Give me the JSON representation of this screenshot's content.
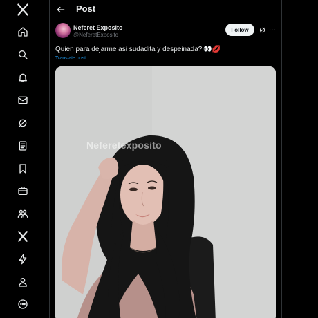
{
  "nav": {
    "items": [
      {
        "icon": "x-logo-icon"
      },
      {
        "icon": "home-icon"
      },
      {
        "icon": "search-icon"
      },
      {
        "icon": "notifications-icon"
      },
      {
        "icon": "messages-icon"
      },
      {
        "icon": "grok-icon"
      },
      {
        "icon": "lists-icon"
      },
      {
        "icon": "bookmarks-icon"
      },
      {
        "icon": "jobs-icon"
      },
      {
        "icon": "communities-icon"
      },
      {
        "icon": "premium-icon"
      },
      {
        "icon": "verified-orgs-icon"
      },
      {
        "icon": "profile-icon"
      },
      {
        "icon": "more-icon"
      }
    ]
  },
  "header": {
    "title": "Post"
  },
  "post": {
    "author_name": "Neferet Exposito",
    "author_handle": "@NeferetExposito",
    "follow_label": "Follow",
    "text": "Quien para dejarme asi sudadita y despeinada?",
    "emojis": "👀💋",
    "translate_label": "Translate post",
    "media_watermark": "Neferetexposito"
  },
  "colors": {
    "background": "#000000",
    "text": "#e7e9ea",
    "muted": "#71767b",
    "link": "#1d9bf0",
    "border": "#2f3336",
    "follow_bg": "#eff3f4"
  }
}
